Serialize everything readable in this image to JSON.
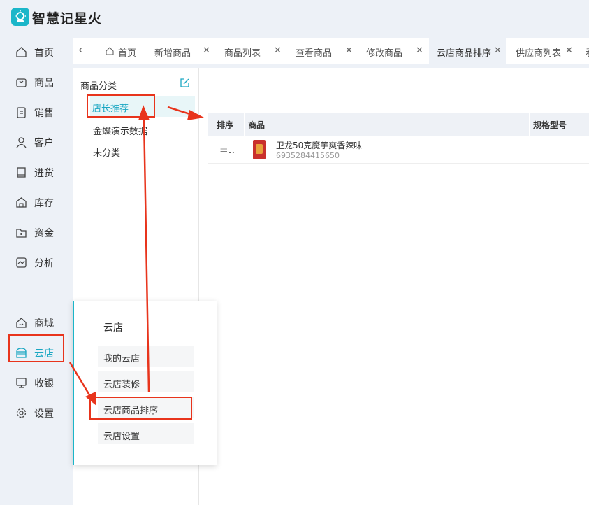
{
  "app": {
    "title": "智慧记星火"
  },
  "sidebar": {
    "items": [
      {
        "label": "首页",
        "icon": "home-icon"
      },
      {
        "label": "商品",
        "icon": "bag-icon"
      },
      {
        "label": "销售",
        "icon": "clipboard-icon"
      },
      {
        "label": "客户",
        "icon": "user-icon"
      },
      {
        "label": "进货",
        "icon": "book-icon"
      },
      {
        "label": "库存",
        "icon": "warehouse-icon"
      },
      {
        "label": "资金",
        "icon": "wallet-icon"
      },
      {
        "label": "分析",
        "icon": "chart-icon"
      },
      {
        "label": "商城",
        "icon": "mall-icon"
      },
      {
        "label": "云店",
        "icon": "store-icon",
        "active": true
      },
      {
        "label": "收银",
        "icon": "register-icon"
      },
      {
        "label": "设置",
        "icon": "gear-icon"
      }
    ]
  },
  "tabs": [
    {
      "label": "首页",
      "closable": false
    },
    {
      "label": "新增商品",
      "closable": true
    },
    {
      "label": "商品列表",
      "closable": true
    },
    {
      "label": "查看商品",
      "closable": true
    },
    {
      "label": "修改商品",
      "closable": true
    },
    {
      "label": "云店商品排序",
      "closable": true,
      "active": true
    },
    {
      "label": "供应商列表",
      "closable": true
    },
    {
      "label": "看",
      "closable": false
    }
  ],
  "tab_close_glyph": "✕",
  "category_panel": {
    "title": "商品分类",
    "items": [
      {
        "label": "店长推荐",
        "active": true
      },
      {
        "label": "金蝶演示数据"
      },
      {
        "label": "未分类"
      }
    ]
  },
  "table": {
    "headers": {
      "sort": "排序",
      "product": "商品",
      "spec": "规格型号"
    },
    "rows": [
      {
        "drag": "≡..",
        "name": "卫龙50克魔芋爽香辣味",
        "code": "6935284415650",
        "spec": "--"
      }
    ]
  },
  "popup": {
    "title": "云店",
    "items": [
      {
        "label": "我的云店"
      },
      {
        "label": "云店装修"
      },
      {
        "label": "云店商品排序",
        "highlighted": true
      },
      {
        "label": "云店设置"
      }
    ]
  },
  "colors": {
    "accent": "#1bb6c9",
    "annotation": "#e8341c"
  }
}
